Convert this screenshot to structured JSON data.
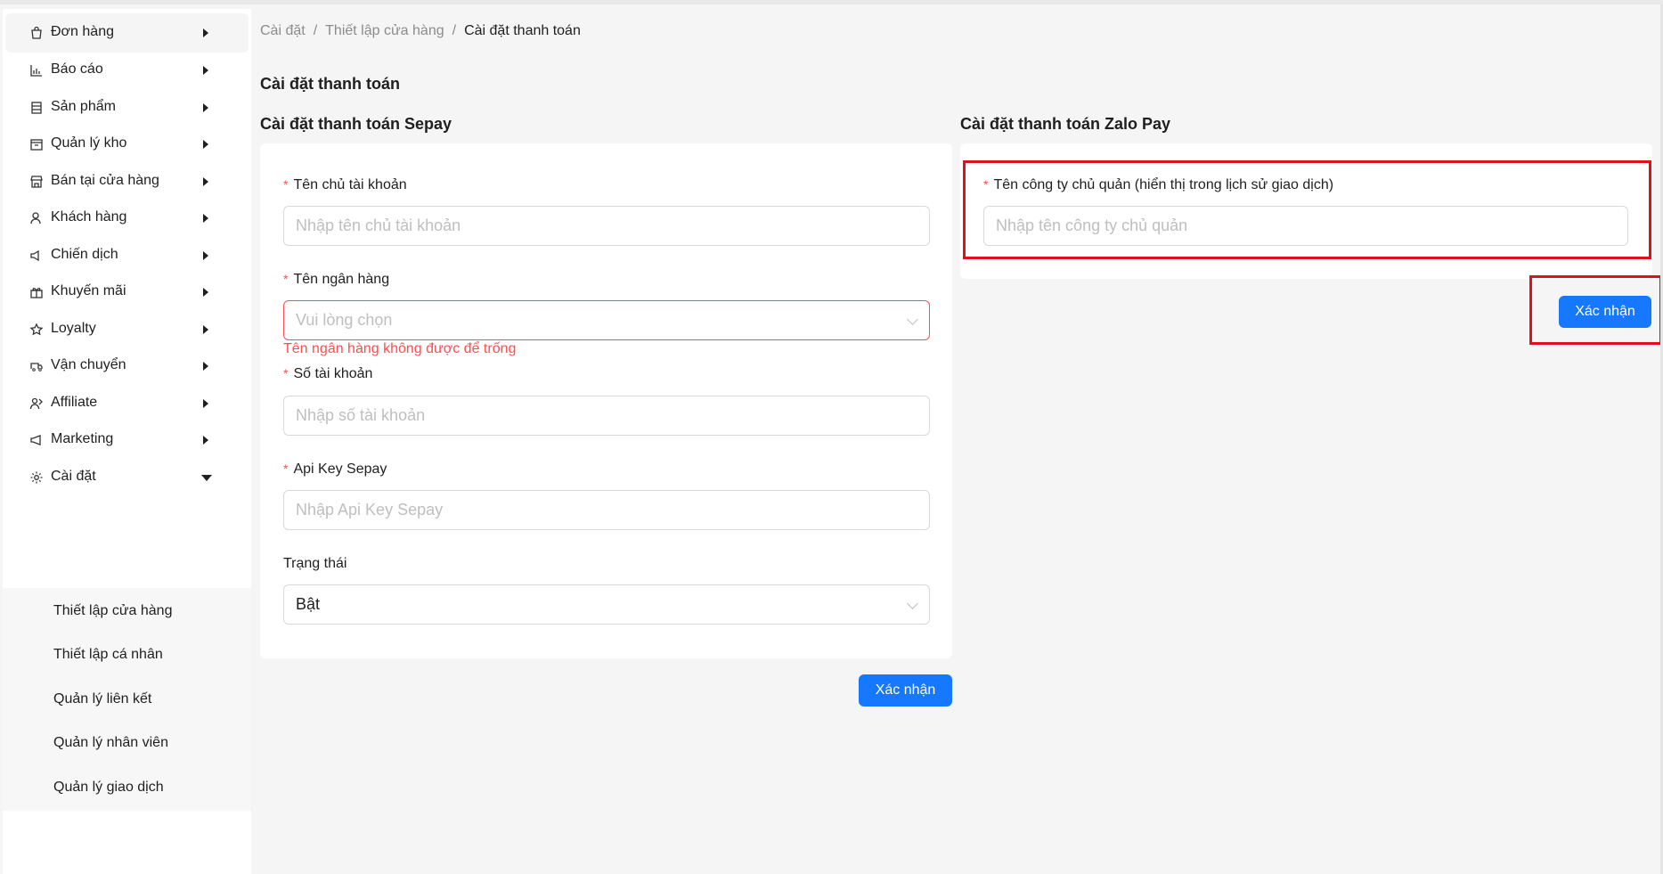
{
  "sidebar": {
    "items": [
      {
        "label": "Đơn hàng",
        "icon": "shopping-bag-icon"
      },
      {
        "label": "Báo cáo",
        "icon": "chart-icon"
      },
      {
        "label": "Sản phẩm",
        "icon": "product-icon"
      },
      {
        "label": "Quản lý kho",
        "icon": "warehouse-icon"
      },
      {
        "label": "Bán tại cửa hàng",
        "icon": "store-icon"
      },
      {
        "label": "Khách hàng",
        "icon": "customer-icon"
      },
      {
        "label": "Chiến dịch",
        "icon": "campaign-icon"
      },
      {
        "label": "Khuyến mãi",
        "icon": "gift-icon"
      },
      {
        "label": "Loyalty",
        "icon": "star-icon"
      },
      {
        "label": "Vận chuyển",
        "icon": "truck-icon"
      },
      {
        "label": "Affiliate",
        "icon": "affiliate-icon"
      },
      {
        "label": "Marketing",
        "icon": "megaphone-icon"
      },
      {
        "label": "Cài đặt",
        "icon": "gear-icon"
      }
    ],
    "submenu": [
      {
        "label": "Thiết lập cửa hàng"
      },
      {
        "label": "Thiết lập cá nhân"
      },
      {
        "label": "Quản lý liên kết"
      },
      {
        "label": "Quản lý nhân viên"
      },
      {
        "label": "Quản lý giao dịch"
      }
    ]
  },
  "breadcrumb": {
    "items": [
      "Cài đặt",
      "Thiết lập cửa hàng",
      "Cài đặt thanh toán"
    ],
    "separator": "/"
  },
  "page": {
    "title": "Cài đặt thanh toán"
  },
  "sepay": {
    "title": "Cài đặt thanh toán Sepay",
    "required_mark": "*",
    "account_name_label": "Tên chủ tài khoản",
    "account_name_placeholder": "Nhập tên chủ tài khoản",
    "account_name_value": "",
    "bank_label": "Tên ngân hàng",
    "bank_placeholder": "Vui lòng chọn",
    "bank_error": "Tên ngân hàng không được để trống",
    "account_number_label": "Số tài khoản",
    "account_number_placeholder": "Nhập số tài khoản",
    "account_number_value": "",
    "api_key_label": "Api Key Sepay",
    "api_key_placeholder": "Nhập Api Key Sepay",
    "api_key_value": "",
    "status_label": "Trạng thái",
    "status_value": "Bật",
    "submit_label": "Xác nhận"
  },
  "zalopay": {
    "title": "Cài đặt thanh toán Zalo Pay",
    "required_mark": "*",
    "company_label": "Tên công ty chủ quản (hiển thị trong lịch sử giao dịch)",
    "company_placeholder": "Nhập tên công ty chủ quản",
    "company_value": "",
    "submit_label": "Xác nhận"
  },
  "colors": {
    "primary": "#1677ff",
    "error": "#ff4d4f",
    "highlight": "#e0111d"
  }
}
